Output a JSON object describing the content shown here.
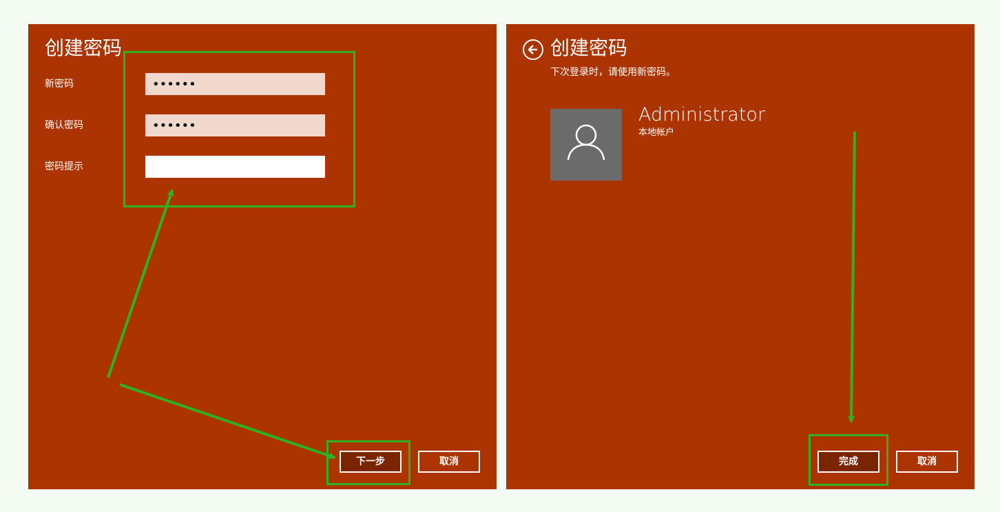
{
  "left_panel": {
    "title": "创建密码",
    "fields": [
      {
        "label": "新密码",
        "value": "••••••"
      },
      {
        "label": "确认密码",
        "value": "••••••"
      },
      {
        "label": "密码提示",
        "value": ""
      }
    ],
    "next_button": "下一步",
    "cancel_button": "取消"
  },
  "right_panel": {
    "title": "创建密码",
    "subtitle": "下次登录时，请使用新密码。",
    "account": {
      "name": "Administrator",
      "type": "本地帐户"
    },
    "finish_button": "完成",
    "cancel_button": "取消"
  },
  "colors": {
    "panel_bg": "#ab3400",
    "page_bg": "#f4fbf3",
    "primary_button_bg": "#7a2400",
    "filled_input_bg": "#f1d8cd",
    "avatar_bg": "#6b6b6b",
    "annotation_green": "#2db31f"
  },
  "icons": {
    "back": "back-arrow-icon",
    "avatar": "user-icon"
  }
}
